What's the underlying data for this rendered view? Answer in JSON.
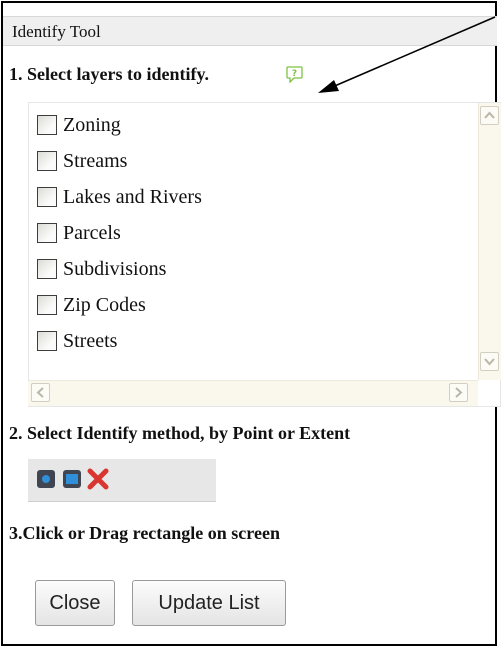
{
  "window": {
    "title": "Identify Tool"
  },
  "step1": {
    "heading": "1. Select layers to identify.",
    "help_icon": "help-speech-bubble-icon",
    "layers": [
      {
        "label": "Zoning",
        "checked": false
      },
      {
        "label": "Streams",
        "checked": false
      },
      {
        "label": "Lakes and Rivers",
        "checked": false
      },
      {
        "label": "Parcels",
        "checked": false
      },
      {
        "label": "Subdivisions",
        "checked": false
      },
      {
        "label": "Zip Codes",
        "checked": false
      },
      {
        "label": "Streets",
        "checked": false
      }
    ]
  },
  "step2": {
    "heading": "2. Select Identify method, by Point or Extent",
    "tools": [
      "identify-point-icon",
      "identify-extent-icon",
      "clear-selection-icon"
    ]
  },
  "step3": {
    "heading": "3.Click or Drag rectangle on screen"
  },
  "buttons": {
    "close": "Close",
    "update_list": "Update List"
  },
  "colors": {
    "help_green": "#7cc242",
    "clear_red": "#d9362f",
    "point_blue": "#2f8fd8"
  }
}
